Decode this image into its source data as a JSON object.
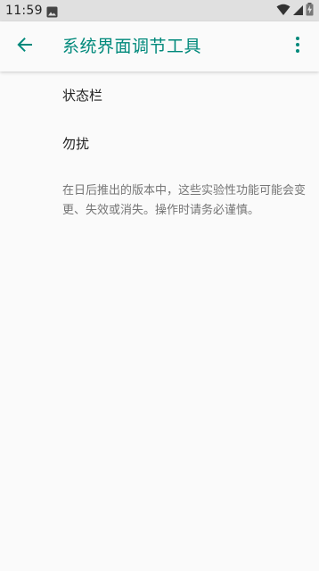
{
  "status_bar": {
    "time": "11:59",
    "icons": [
      "image-notification-icon",
      "wifi-icon",
      "cell-signal-icon",
      "battery-charging-icon"
    ]
  },
  "app_bar": {
    "title": "系统界面调节工具",
    "back_icon": "arrow-back-icon",
    "menu_icon": "more-vert-icon",
    "accent_color": "#00897b"
  },
  "preferences": [
    {
      "label": "状态栏"
    },
    {
      "label": "勿扰"
    }
  ],
  "footer": {
    "text": "在日后推出的版本中，这些实验性功能可能会变更、失效或消失。操作时请务必谨慎。"
  }
}
